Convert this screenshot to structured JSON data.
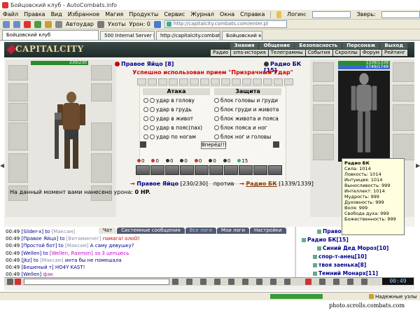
{
  "window": {
    "title": "Бойцовский клуб - AutoCombats.info"
  },
  "menu": {
    "items": [
      "Файл",
      "Правка",
      "Вид",
      "Избранное",
      "Магия",
      "Продукты",
      "Сервис",
      "Журнал",
      "Окна",
      "Справка"
    ],
    "login_label": "Логин:",
    "monster_label": "Зверь:"
  },
  "toolbar": {
    "autoudar": "Автоудар",
    "uhotu": "Ухоты",
    "uron": "Урон: 0",
    "address": "http://capitalcity.combats.com/enter.pl"
  },
  "tabs": [
    "Бойцовский клуб",
    "500 Internal Server Error",
    "http://capitalcity.combats.co...",
    "Бойцовский клуб"
  ],
  "game": {
    "logo": "CAPITALCITY",
    "nav_top": [
      "Знания",
      "Общение",
      "Безопасность",
      "Персонаж",
      "Выход"
    ],
    "nav_bottom": [
      "Радио",
      "sms-история",
      "Телеграммы",
      "События",
      "Скроллы",
      "Форум",
      "Рейтинг"
    ],
    "left_hp": "230/230",
    "right_hp": "1339/1339",
    "right_mana": "1749/1749",
    "fighter_left": "Правое Яйцо [8]",
    "fighter_right": "Радио БК [15]",
    "success_msg": "Успешно использован прием \"Призрачный Удар\"",
    "attack_title": "Атака",
    "defense_title": "Защита",
    "attacks": [
      "удар в голову",
      "удар в грудь",
      "удар в живот",
      "удар в пояс(пах)",
      "удар по ногам"
    ],
    "defenses": [
      "блок головы и груди",
      "блок груди и живота",
      "блок живота и пояса",
      "блок пояса и ног",
      "блок ног и головы"
    ],
    "go_button": "Вперёд!!!",
    "effects": [
      "0",
      "0",
      "0",
      "0",
      "0",
      "0",
      "0",
      "15"
    ],
    "vs_left": "Правое Яйцо",
    "vs_left_hp": "[230/230]",
    "vs_word": "против",
    "vs_right": "Радио БК",
    "vs_right_hp": "[1339/1339]",
    "damage_prefix": "На данный момент вами нанесено урона:",
    "damage_value": "0 HP.",
    "ks_suffix": "ks",
    "tooltip": {
      "title": "Радио БК",
      "lines": [
        "Сила: 1014",
        "Ловкость: 1014",
        "Интуиция: 1014",
        "Выносливость: 999",
        "Интеллект: 1014",
        "Мудрость: 999",
        "Духовность: 999",
        "Воля: 999",
        "Свобода духа: 999",
        "Божественность: 999"
      ]
    }
  },
  "chat": {
    "tabs": [
      "Чат",
      "Системные сообщения",
      "Все логи",
      "Мои логи",
      "Настройки"
    ],
    "lines": [
      {
        "t": "00:49",
        "who": "[Slider-x]",
        "to": "to",
        "tgt": "[Максам]",
        "msg": ""
      },
      {
        "t": "00:49",
        "who": "[Правое Яйцо]",
        "to": "to",
        "tgt": "[Витаминчег]",
        "msg": "памага! олоО!"
      },
      {
        "t": "00:49",
        "who": "[Простой бот]",
        "to": "to",
        "tgt": "[Максам]",
        "msg": "А саму девушку?"
      },
      {
        "t": "00:49",
        "who": "[Wellen]",
        "to": "to",
        "tgt": "[Wellen, Raxmon]",
        "msg": "за 3 цепцюсь"
      },
      {
        "t": "00:49",
        "who": "[Jkz]",
        "to": "to",
        "tgt": "[Максам]",
        "msg": "инта бы не помешала"
      },
      {
        "t": "00:49",
        "who": "[Бешеный т]",
        "to": "",
        "tgt": "",
        "msg": "HO4Y KAST!"
      },
      {
        "t": "00:49",
        "who": "[Wellen]",
        "to": "",
        "tgt": "",
        "msg": "фак"
      }
    ],
    "online": [
      "Правое Яйцо[8]",
      "Радио БК[15]",
      "Синий Дед Мороз[10]",
      "спор-т-анец[10]",
      "твоя заенька[8]",
      "Темний Монарх[11]"
    ]
  },
  "clock": "00:49",
  "status": {
    "progress_percent": 100,
    "secure": "Надежные узлы"
  },
  "watermark": "photo.scrolls.combats.com"
}
